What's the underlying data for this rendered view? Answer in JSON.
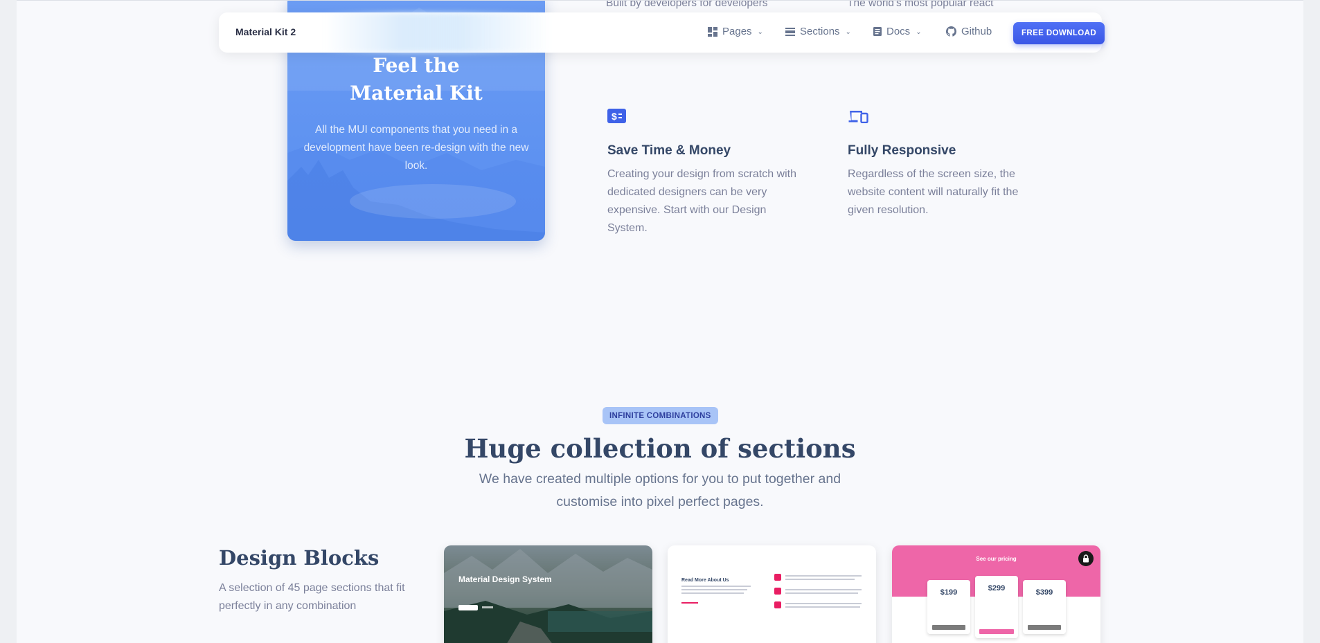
{
  "navbar": {
    "brand": "Material Kit 2",
    "items": [
      {
        "label": "Pages",
        "icon": "dashboard-grid-icon",
        "has_dropdown": true
      },
      {
        "label": "Sections",
        "icon": "view-day-icon",
        "has_dropdown": true
      },
      {
        "label": "Docs",
        "icon": "article-icon",
        "has_dropdown": true
      },
      {
        "label": "Github",
        "icon": "github-icon",
        "has_dropdown": false
      }
    ],
    "cta": "FREE DOWNLOAD"
  },
  "top_clipped": {
    "left": "Built by developers for developers",
    "right": "The world's most popular react"
  },
  "hero_card": {
    "title_line1": "Feel the",
    "title_line2": "Material Kit",
    "subtitle": "All the MUI components that you need in a development have been re-design with the new look."
  },
  "features": [
    {
      "icon": "payments-icon",
      "title": "Save Time & Money",
      "text": "Creating your design from scratch with dedicated designers can be very expensive. Start with our Design System."
    },
    {
      "icon": "devices-icon",
      "title": "Fully Responsive",
      "text": "Regardless of the screen size, the website content will naturally fit the given resolution."
    }
  ],
  "section": {
    "badge": "INFINITE COMBINATIONS",
    "title": "Huge collection of sections",
    "subtitle": "We have created multiple options for you to put together and customise into pixel perfect pages."
  },
  "design_blocks": {
    "title": "Design Blocks",
    "text": "A selection of 45 page sections that fit perfectly in any combination",
    "thumbnails": [
      {
        "title": "Material Design System"
      },
      {
        "title": "Read More About Us"
      },
      {
        "title": "See our pricing",
        "prices": [
          "$199",
          "$299",
          "$399"
        ]
      }
    ]
  },
  "colors": {
    "accent": "#3a56e6",
    "hero": "#6c9cf3",
    "pink": "#ee66a8",
    "heading": "#344767",
    "body_text": "#7b809a"
  }
}
